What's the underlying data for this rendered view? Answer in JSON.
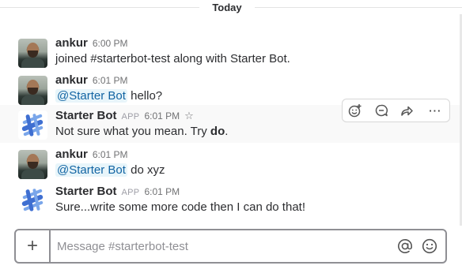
{
  "day_divider": "Today",
  "messages": [
    {
      "author": "ankur",
      "time": "6:00 PM",
      "text": "joined #starterbot-test along with Starter Bot."
    },
    {
      "author": "ankur",
      "time": "6:01 PM",
      "mention": "@Starter Bot",
      "text": " hello?"
    },
    {
      "author": "Starter Bot",
      "tag": "APP",
      "time": "6:01 PM",
      "text_before": "Not sure what you mean. Try ",
      "text_bold": "do",
      "text_after": "."
    },
    {
      "author": "ankur",
      "time": "6:01 PM",
      "mention": "@Starter Bot",
      "text": " do xyz"
    },
    {
      "author": "Starter Bot",
      "tag": "APP",
      "time": "6:01 PM",
      "text": "Sure...write some more code then I can do that!"
    }
  ],
  "icons": {
    "add_reaction": "add-reaction-icon",
    "reply": "reply-icon",
    "share": "share-icon",
    "more": "more-icon",
    "star": "star-icon"
  },
  "more_label": "···",
  "composer": {
    "plus_label": "+",
    "placeholder": "Message #starterbot-test"
  },
  "colors": {
    "mention_text": "#1264a3",
    "mention_bg": "#e8f5fa",
    "bot_logo_blue": "#3f6fd1",
    "bot_logo_light": "#7aa6ea"
  }
}
